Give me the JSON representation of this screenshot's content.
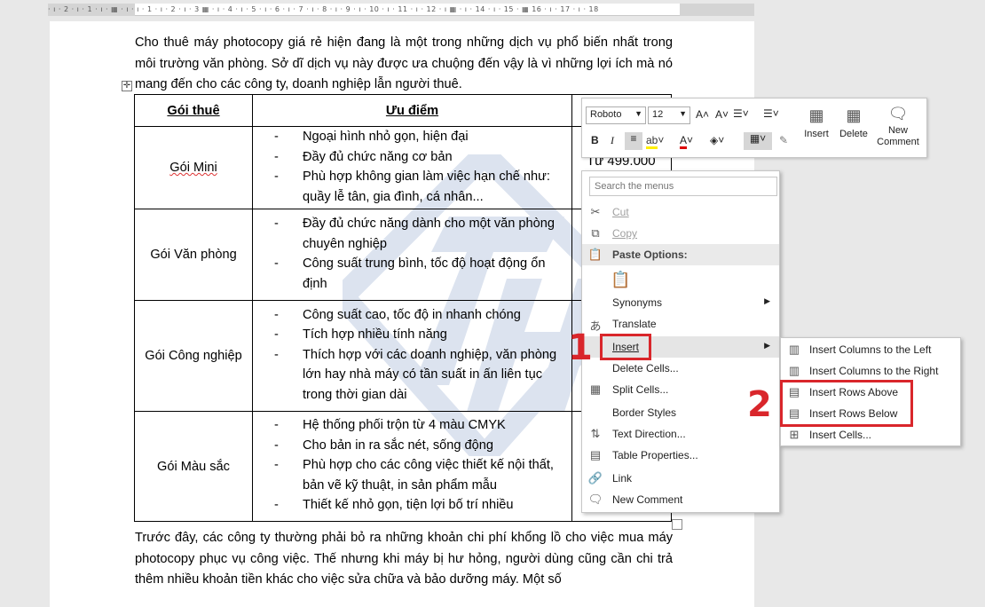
{
  "ruler": {
    "marks": "· ı · 2 · ı · 1 · ı · ▦ · ı · ı · 1 · ı · 2 · ı · 3 ▦ · ı · 4 · ı · 5 · ı · 6 · ı · 7 · ı · 8 · ı · 9 · ı · 10 · ı · 11 · ı · 12 · ı ▦ · ı · 14 · ı · 15 · ▦ 16 · ı · 17 · ı · 18"
  },
  "document": {
    "intro": "Cho thuê máy photocopy giá rẻ hiện đang là một trong những dịch vụ phổ biến nhất trong môi trường văn phòng. Sở dĩ dịch vụ này được ưa chuộng đến vậy là vì những lợi ích mà nó mang đến cho các công ty, doanh nghiệp lẫn người thuê.",
    "table": {
      "headers": [
        "Gói thuê",
        "Ưu điểm",
        ""
      ],
      "rows": [
        {
          "name": "Gói Mini",
          "points": [
            "Ngoại hình nhỏ gọn, hiện đại",
            "Đầy đủ chức năng cơ bản",
            "Phù hợp không gian làm việc hạn chế như: quầy lễ tân, gia đình, cá nhân..."
          ],
          "price": "Từ 499.000"
        },
        {
          "name": "Gói Văn phòng",
          "points": [
            "Đầy đủ chức năng dành cho một văn phòng chuyên nghiệp",
            "Công suất trung bình, tốc độ hoạt động ổn định"
          ],
          "price": ""
        },
        {
          "name": "Gói Công nghiệp",
          "points": [
            "Công suất cao, tốc độ in nhanh chóng",
            "Tích hợp nhiều tính năng",
            "Thích hợp với các doanh nghiệp, văn phòng lớn hay nhà máy có tần suất in ấn liên tục trong thời gian dài"
          ],
          "price": ""
        },
        {
          "name": "Gói Màu sắc",
          "points": [
            "Hệ thống phối trộn từ 4 màu CMYK",
            "Cho bản in ra sắc nét, sống động",
            "Phù hợp cho các công việc thiết kế nội thất, bản vẽ kỹ thuật, in sản phẩm mẫu",
            "Thiết kế nhỏ gọn, tiện lợi bố trí nhiều"
          ],
          "price": ""
        }
      ]
    },
    "outro": "Trước đây, các công ty thường phải bỏ ra những khoản chi phí khổng lồ cho việc mua máy photocopy phục vụ công việc. Thế nhưng khi máy bị hư hỏng, người dùng cũng cần chi trả thêm nhiều khoản tiền khác cho việc sửa chữa và bảo dưỡng máy. Một số"
  },
  "mini_toolbar": {
    "font": "Roboto",
    "size": "12",
    "insert_label": "Insert",
    "delete_label": "Delete",
    "new_comment_label": "New Comment"
  },
  "context_menu": {
    "search_placeholder": "Search the menus",
    "items": {
      "cut": "Cut",
      "copy": "Copy",
      "paste_options": "Paste Options:",
      "synonyms": "Synonyms",
      "translate": "Translate",
      "insert": "Insert",
      "delete_cells": "Delete Cells...",
      "split_cells": "Split Cells...",
      "border_styles": "Border Styles",
      "text_direction": "Text Direction...",
      "table_properties": "Table Properties...",
      "link": "Link",
      "new_comment": "New Comment"
    }
  },
  "insert_submenu": {
    "cols_left": "Insert Columns to the Left",
    "cols_right": "Insert Columns to the Right",
    "rows_above": "Insert Rows Above",
    "rows_below": "Insert Rows Below",
    "cells": "Insert Cells..."
  },
  "annotations": {
    "step1": "1",
    "step2": "2",
    "color": "#d9262b"
  },
  "icons": [
    "table-move-handle-icon",
    "cut-icon",
    "copy-icon",
    "paste-icon",
    "translate-icon",
    "split-cells-icon",
    "text-direction-icon",
    "table-properties-icon",
    "link-icon",
    "comment-icon"
  ]
}
